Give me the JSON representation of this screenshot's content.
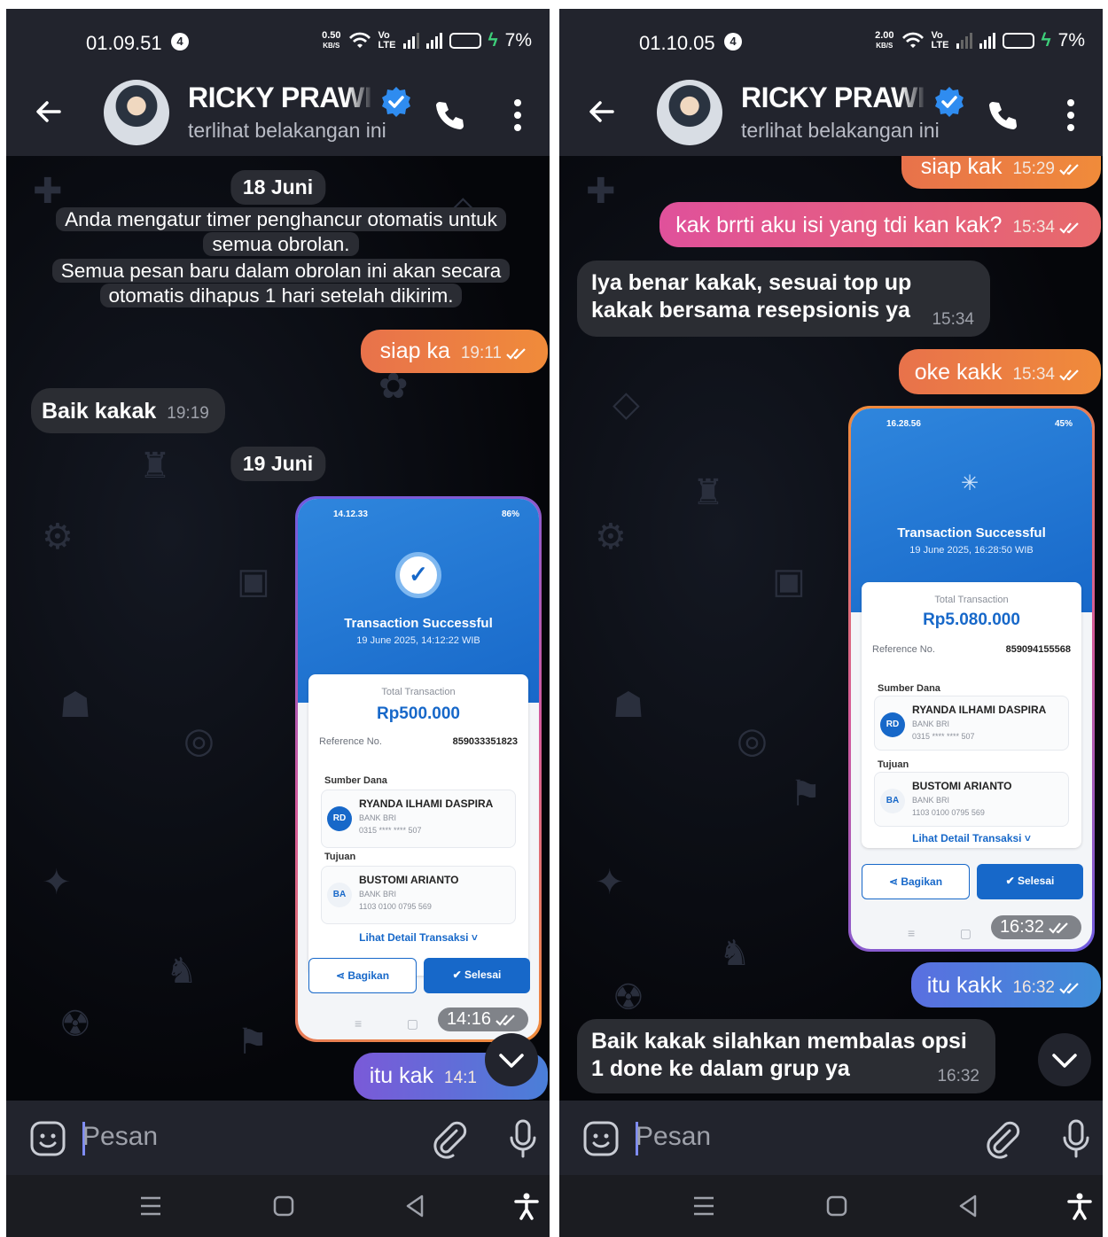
{
  "screens": [
    {
      "status": {
        "time": "01.09.51",
        "notif_count": "4",
        "speed": "0.50",
        "speed_unit": "KB/S",
        "volte": "Vo LTE",
        "battery": "7%"
      },
      "header": {
        "name": "RICKY PRAWI",
        "subtitle": "terlihat belakangan ini"
      },
      "messages": {
        "date1": "18 Juni",
        "system1": "Anda mengatur timer penghancur otomatis untuk semua obrolan.",
        "system2": "Semua pesan baru dalam obrolan ini akan secara otomatis dihapus 1 hari setelah dikirim.",
        "out1": {
          "text": "siap ka",
          "time": "19:11"
        },
        "in1": {
          "text": "Baik kakak",
          "time": "19:19"
        },
        "date2": "19 Juni",
        "tx_time": "14:16",
        "out2": {
          "text": "itu kak",
          "time": "14:1"
        }
      },
      "tx": {
        "status_time": "14.12.33",
        "status_right": "86%",
        "title": "Transaction Successful",
        "date": "19 June 2025, 14:12:22 WIB",
        "total_label": "Total Transaction",
        "amount": "Rp500.000",
        "ref_label": "Reference No.",
        "ref_value": "859033351823",
        "source_label": "Sumber Dana",
        "source_initials": "RD",
        "source_name": "RYANDA ILHAMI DASPIRA",
        "source_bank": "BANK BRI",
        "source_acct": "0315 **** **** 507",
        "dest_label": "Tujuan",
        "dest_initials": "BA",
        "dest_name": "BUSTOMI ARIANTO",
        "dest_bank": "BANK BRI",
        "dest_acct": "1103 0100 0795 569",
        "detail_link": "Lihat Detail Transaksi ˅",
        "share": "Bagikan",
        "done": "Selesai"
      },
      "input_placeholder": "Pesan"
    },
    {
      "status": {
        "time": "01.10.05",
        "notif_count": "4",
        "speed": "2.00",
        "speed_unit": "KB/S",
        "volte": "Vo LTE",
        "battery": "7%"
      },
      "header": {
        "name": "RICKY PRAWI",
        "subtitle": "terlihat belakangan ini"
      },
      "messages": {
        "out0": {
          "text": "siap kak",
          "time": "15:29"
        },
        "out1": {
          "text": "kak brrti aku isi yang tdi kan kak?",
          "time": "15:34"
        },
        "in1": {
          "text": "Iya benar kakak, sesuai top up kakak bersama resepsionis ya",
          "time": "15:34"
        },
        "out2": {
          "text": "oke kakk",
          "time": "15:34"
        },
        "tx_time": "16:32",
        "out3": {
          "text": "itu kakk",
          "time": "16:32"
        },
        "in2": {
          "text": "Baik kakak silahkan membalas opsi 1 done ke dalam grup ya",
          "time": "16:32"
        }
      },
      "tx": {
        "status_time": "16.28.56",
        "status_right": "45%",
        "title": "Transaction Successful",
        "date": "19 June 2025, 16:28:50 WIB",
        "total_label": "Total Transaction",
        "amount": "Rp5.080.000",
        "ref_label": "Reference No.",
        "ref_value": "859094155568",
        "source_label": "Sumber Dana",
        "source_initials": "RD",
        "source_name": "RYANDA ILHAMI DASPIRA",
        "source_bank": "BANK BRI",
        "source_acct": "0315 **** **** 507",
        "dest_label": "Tujuan",
        "dest_initials": "BA",
        "dest_name": "BUSTOMI ARIANTO",
        "dest_bank": "BANK BRI",
        "dest_acct": "1103 0100 0795 569",
        "detail_link": "Lihat Detail Transaksi ˅",
        "share": "Bagikan",
        "done": "Selesai"
      },
      "input_placeholder": "Pesan"
    }
  ],
  "colors": {
    "header_bg": "#22242d",
    "outgoing_bubble": "#ef7f42",
    "outgoing_bubble_alt": "#e0519b",
    "outgoing_bubble_blue": "#4a7fd8",
    "incoming_bubble": "#2b2d33",
    "verified": "#2f8cf0",
    "bank_blue": "#1768c9"
  },
  "icons": [
    "arrow-left-icon",
    "verified-badge-icon",
    "phone-icon",
    "more-vert-icon",
    "sticker-icon",
    "paperclip-icon",
    "microphone-icon",
    "chevron-down-icon",
    "menu-icon",
    "home-icon",
    "back-icon",
    "accessibility-icon",
    "double-check-icon",
    "share-icon",
    "check-circle-icon"
  ]
}
